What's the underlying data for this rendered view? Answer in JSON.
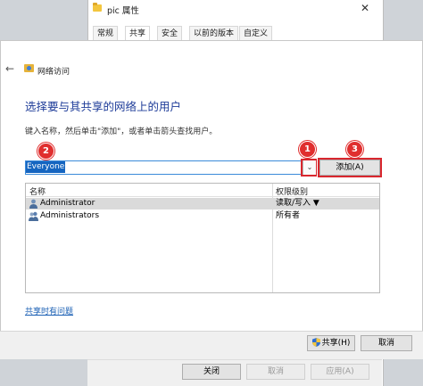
{
  "props_window": {
    "title": "pic 属性",
    "tabs": [
      "常规",
      "共享",
      "安全",
      "以前的版本",
      "自定义"
    ],
    "active_tab": "共享",
    "close_glyph": "✕",
    "buttons": {
      "close": "关闭",
      "cancel": "取消",
      "apply": "应用(A)"
    }
  },
  "wizard": {
    "back_glyph": "←",
    "title": "网络访问",
    "heading": "选择要与其共享的网络上的用户",
    "instruction": "键入名称，然后单击\"添加\"，或者单击箭头查找用户。",
    "combo_value": "Everyone",
    "combo_arrow": "⌄",
    "add_button": "添加(A)",
    "list": {
      "columns": [
        "名称",
        "权限级别"
      ],
      "rows": [
        {
          "name": "Administrator",
          "permission": "读取/写入 ▼",
          "selected": true
        },
        {
          "name": "Administrators",
          "permission": "所有者",
          "selected": false
        }
      ]
    },
    "help_link": "共享时有问题",
    "share_button": "共享(H)",
    "cancel_button": "取消",
    "badges": [
      "1",
      "2",
      "3"
    ]
  },
  "colors": {
    "accent": "#1f3d99",
    "highlight": "#d9272e",
    "selection": "#1565c0"
  },
  "icons": [
    "folder-icon",
    "back-arrow-icon",
    "network-folder-icon",
    "user-icon",
    "group-icon",
    "shield-icon",
    "chevron-down-icon",
    "close-icon"
  ]
}
